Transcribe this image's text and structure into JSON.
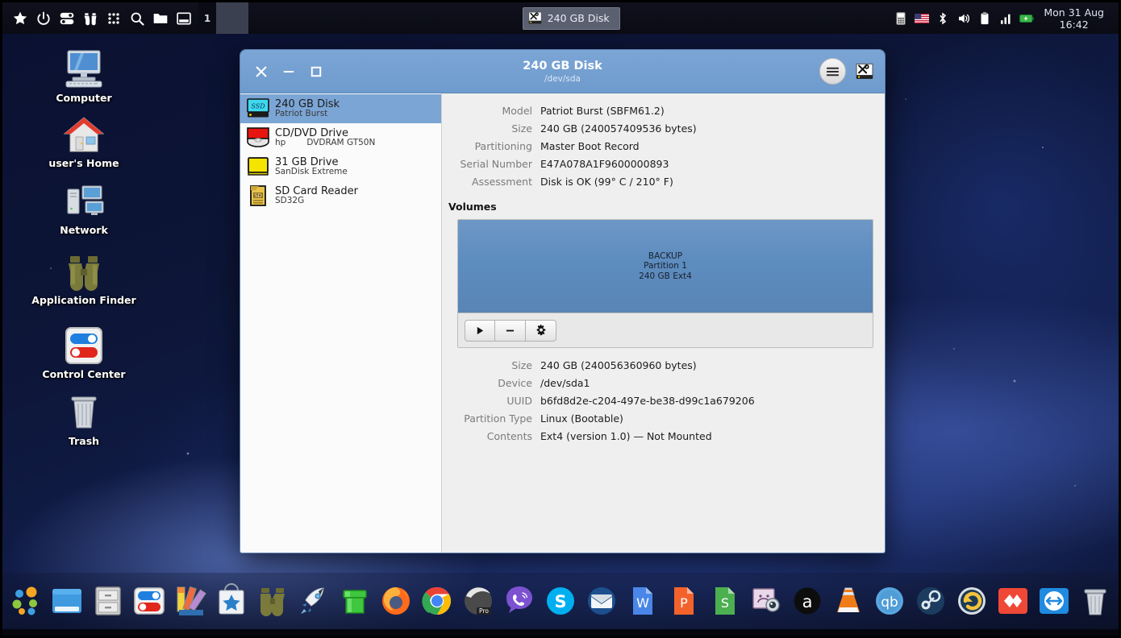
{
  "panel": {
    "launcher_icons": [
      {
        "name": "whisker-menu-star-icon",
        "glyph": "star"
      },
      {
        "name": "power-icon",
        "glyph": "power"
      },
      {
        "name": "switch-user-icon",
        "glyph": "switch"
      },
      {
        "name": "binoculars-finder-icon",
        "glyph": "binoculars"
      },
      {
        "name": "grid-apps-icon",
        "glyph": "grid"
      },
      {
        "name": "search-icon",
        "glyph": "search"
      },
      {
        "name": "folder-icon",
        "glyph": "folder"
      },
      {
        "name": "show-desktop-icon",
        "glyph": "window"
      }
    ],
    "workspace": "1",
    "taskbar_window": {
      "label": "240 GB Disk",
      "icon": "disks-utility-icon"
    },
    "tray_icons": [
      {
        "name": "phone-keypad-icon"
      },
      {
        "name": "us-flag-keyboard-layout-icon"
      },
      {
        "name": "bluetooth-icon"
      },
      {
        "name": "volume-icon"
      },
      {
        "name": "clipboard-icon"
      },
      {
        "name": "signal-bars-icon"
      },
      {
        "name": "battery-icon"
      }
    ],
    "clock": {
      "date": "Mon 31 Aug",
      "time": "16:42"
    }
  },
  "desktop_icons": [
    {
      "label": "Computer",
      "icon": "computer-icon"
    },
    {
      "label": "user's Home",
      "icon": "home-icon"
    },
    {
      "label": "Network",
      "icon": "network-icon"
    },
    {
      "label": "Application Finder",
      "icon": "binoculars-icon"
    },
    {
      "label": "Control Center",
      "icon": "control-center-icon"
    },
    {
      "label": "Trash",
      "icon": "trash-icon"
    }
  ],
  "window": {
    "title": "240 GB Disk",
    "subtitle": "/dev/sda",
    "controls": {
      "close": "close-button",
      "minimize": "minimize-button",
      "maximize": "maximize-button"
    },
    "menu_button": "hamburger-menu-button",
    "app_icon": "disks-utility-icon",
    "titlebar_color": "#74a0d0"
  },
  "sidebar": {
    "devices": [
      {
        "name": "240 GB Disk",
        "model": "Patriot Burst",
        "icon": "ssd-icon",
        "selected": true
      },
      {
        "name": "CD/DVD Drive",
        "model": "hp",
        "model2": "DVDRAM GT50N",
        "icon": "optical-disc-icon",
        "selected": false
      },
      {
        "name": "31 GB Drive",
        "model": "SanDisk Extreme",
        "icon": "usb-drive-icon",
        "selected": false
      },
      {
        "name": "SD Card Reader",
        "model": "SD32G",
        "icon": "sd-card-icon",
        "selected": false
      }
    ]
  },
  "drive_details": [
    {
      "key": "Model",
      "value": "Patriot Burst (SBFM61.2)"
    },
    {
      "key": "Size",
      "value": "240 GB (240057409536 bytes)"
    },
    {
      "key": "Partitioning",
      "value": "Master Boot Record"
    },
    {
      "key": "Serial Number",
      "value": "E47A078A1F9600000893"
    },
    {
      "key": "Assessment",
      "value": "Disk is OK (99° C / 210° F)"
    }
  ],
  "volumes": {
    "section_label": "Volumes",
    "partition": {
      "label": "BACKUP",
      "number": "Partition 1",
      "size_type": "240 GB Ext4",
      "color": "#5d8cbf"
    },
    "toolbar": [
      {
        "name": "mount-volume-button",
        "glyph": "play"
      },
      {
        "name": "delete-partition-button",
        "glyph": "minus"
      },
      {
        "name": "volume-options-button",
        "glyph": "gear"
      }
    ]
  },
  "volume_details": [
    {
      "key": "Size",
      "value": "240 GB (240056360960 bytes)"
    },
    {
      "key": "Device",
      "value": "/dev/sda1"
    },
    {
      "key": "UUID",
      "value": "b6fd8d2e-c204-497e-be38-d99c1a679206"
    },
    {
      "key": "Partition Type",
      "value": "Linux (Bootable)"
    },
    {
      "key": "Contents",
      "value": "Ext4 (version 1.0) — Not Mounted"
    }
  ],
  "dock": {
    "items": [
      {
        "name": "whisker-star-icon"
      },
      {
        "name": "app-dots-icon"
      },
      {
        "name": "window-manager-icon"
      },
      {
        "name": "file-cabinet-icon"
      },
      {
        "name": "control-center-icon"
      },
      {
        "name": "color-palette-icon"
      },
      {
        "name": "app-store-bag-icon"
      },
      {
        "name": "binoculars-icon"
      },
      {
        "name": "rocket-launcher-icon"
      },
      {
        "name": "green-pipe-icon"
      },
      {
        "name": "firefox-icon"
      },
      {
        "name": "chrome-icon"
      },
      {
        "name": "opera-pro-icon"
      },
      {
        "name": "viber-icon"
      },
      {
        "name": "skype-icon"
      },
      {
        "name": "mail-icon"
      },
      {
        "name": "writer-icon"
      },
      {
        "name": "impress-icon"
      },
      {
        "name": "calc-icon"
      },
      {
        "name": "screenshot-tool-icon"
      },
      {
        "name": "audacious-icon"
      },
      {
        "name": "vlc-icon"
      },
      {
        "name": "qbittorrent-icon"
      },
      {
        "name": "steam-icon"
      },
      {
        "name": "restore-backup-icon"
      },
      {
        "name": "anydesk-icon"
      },
      {
        "name": "teamviewer-icon"
      },
      {
        "name": "trash-icon"
      },
      {
        "name": "disks-utility-icon",
        "running": true
      }
    ]
  }
}
